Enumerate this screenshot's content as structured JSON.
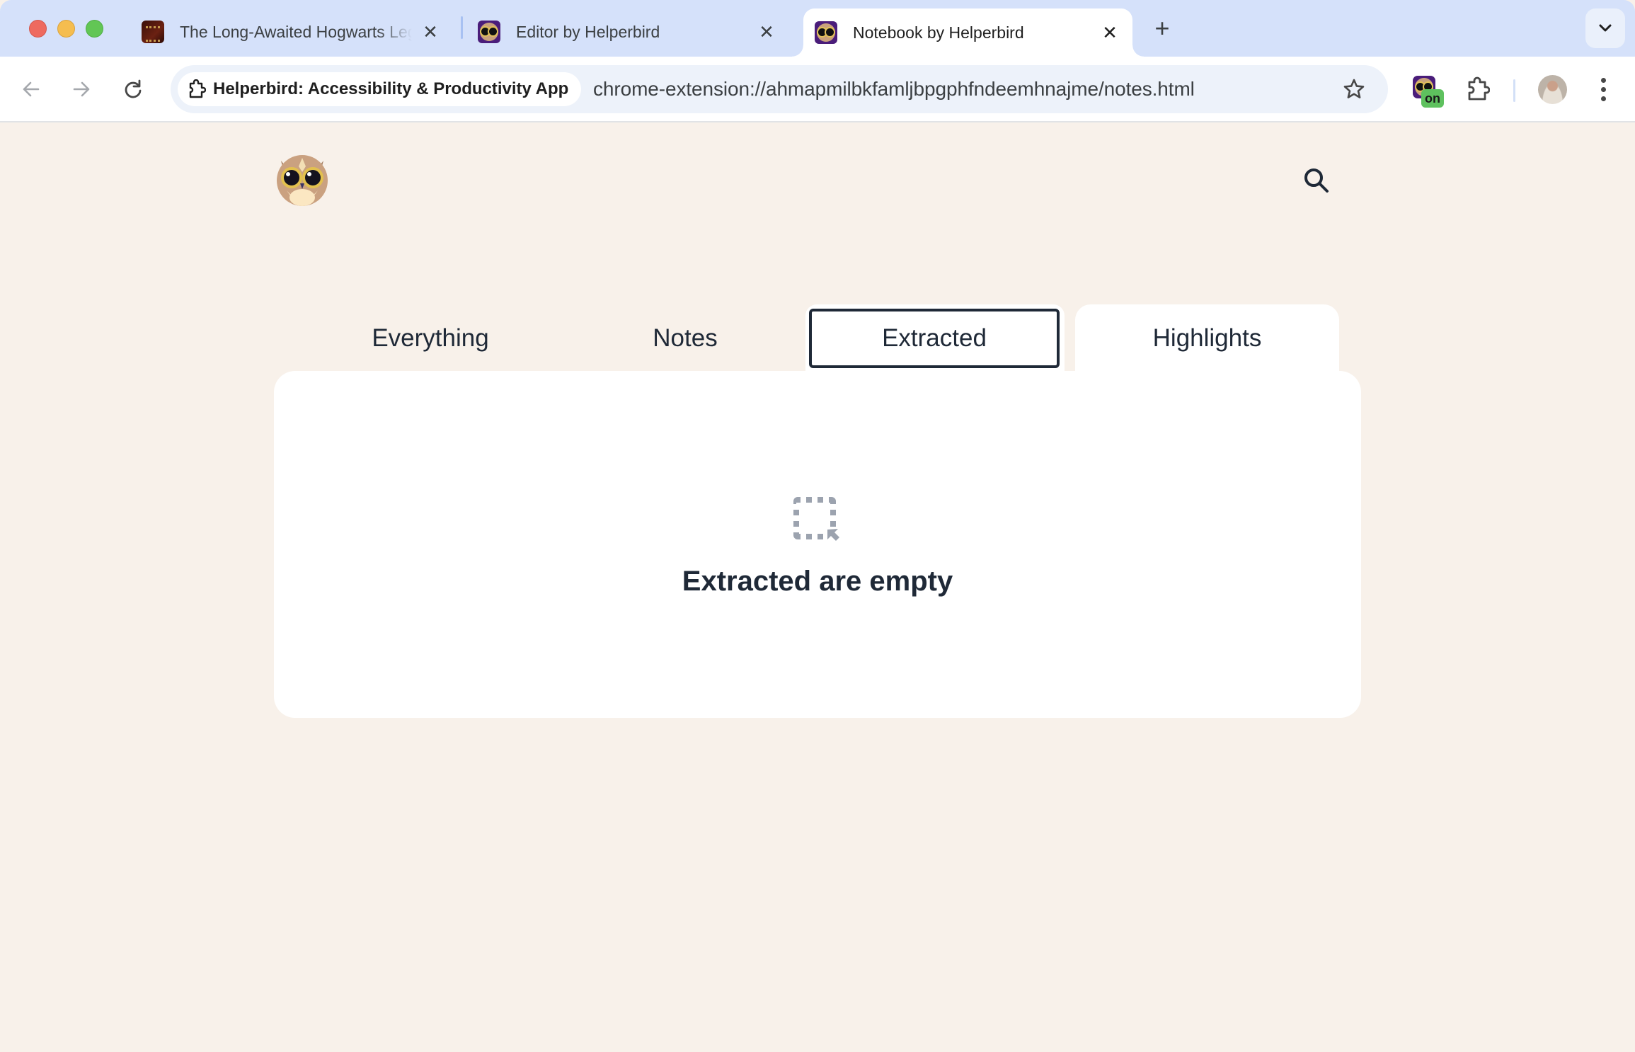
{
  "browser": {
    "tabs": [
      {
        "title": "The Long-Awaited Hogwarts Legacy",
        "favicon": "hogwarts-book-favicon",
        "active": false
      },
      {
        "title": "Editor by Helperbird",
        "favicon": "helperbird-owl-favicon",
        "active": false
      },
      {
        "title": "Notebook by Helperbird",
        "favicon": "helperbird-owl-favicon",
        "active": true
      }
    ],
    "new_tab_label": "+",
    "close_glyph": "✕",
    "site_chip_label": "Helperbird: Accessibility & Productivity App",
    "url": "chrome-extension://ahmapmilbkfamljbpgphfndeemhnajme/notes.html",
    "extension_badge": "on",
    "icons": {
      "back": "arrow-left-icon",
      "forward": "arrow-right-icon",
      "reload": "reload-icon",
      "bookmark": "star-icon",
      "extensions": "puzzle-icon",
      "menu": "kebab-menu-icon",
      "tab_search": "chevron-down-icon"
    }
  },
  "app": {
    "logo": "helperbird-owl-logo",
    "search_icon": "search-icon",
    "tabs": [
      {
        "label": "Everything",
        "selected": false
      },
      {
        "label": "Notes",
        "selected": false
      },
      {
        "label": "Extracted",
        "selected": true,
        "focused": true
      },
      {
        "label": "Highlights",
        "selected": false
      }
    ],
    "empty_state": {
      "icon": "select-region-icon",
      "title": "Extracted are empty"
    }
  },
  "colors": {
    "page_background": "#f8f1ea",
    "card_background": "#ffffff",
    "text_primary": "#1f2937",
    "empty_icon": "#9ca3af",
    "tabstrip": "#d5e1fa",
    "omnibox": "#edf2fa",
    "badge_green": "#5ec15e",
    "helperbird_purple": "#4a1d7a"
  }
}
